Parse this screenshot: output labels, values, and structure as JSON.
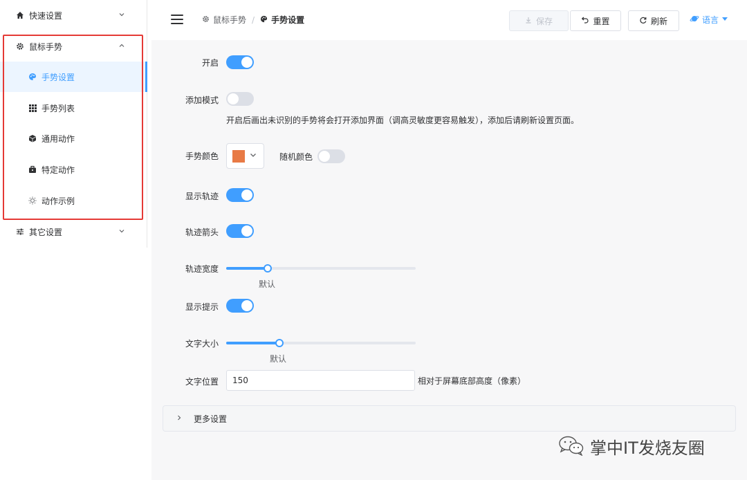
{
  "sidebar": {
    "items": [
      {
        "label": "快速设置",
        "icon": "home-icon",
        "expanded": false
      },
      {
        "label": "鼠标手势",
        "icon": "gear-icon",
        "expanded": true
      },
      {
        "label": "手势设置",
        "icon": "palette-icon",
        "active": true
      },
      {
        "label": "手势列表",
        "icon": "grid-icon"
      },
      {
        "label": "通用动作",
        "icon": "cube-icon"
      },
      {
        "label": "特定动作",
        "icon": "briefcase-icon"
      },
      {
        "label": "动作示例",
        "icon": "bulb-icon"
      },
      {
        "label": "其它设置",
        "icon": "sliders-icon",
        "expanded": false
      }
    ]
  },
  "header": {
    "breadcrumb": {
      "parent": "鼠标手势",
      "separator": "/",
      "current": "手势设置"
    },
    "save_label": "保存",
    "reset_label": "重置",
    "refresh_label": "刷新",
    "language_label": "语言"
  },
  "settings": {
    "enable": {
      "label": "开启",
      "value": true
    },
    "add_mode": {
      "label": "添加模式",
      "value": false,
      "hint": "开启后画出未识别的手势将会打开添加界面（调高灵敏度更容易触发），添加后请刷新设置页面。"
    },
    "gesture_color": {
      "label": "手势颜色",
      "value": "#e87a45"
    },
    "random_color": {
      "label": "随机颜色",
      "value": false
    },
    "show_trail": {
      "label": "显示轨迹",
      "value": true
    },
    "trail_arrow": {
      "label": "轨迹箭头",
      "value": true
    },
    "trail_width": {
      "label": "轨迹宽度",
      "fraction": 0.22,
      "caption": "默认"
    },
    "show_hint": {
      "label": "显示提示",
      "value": true
    },
    "text_size": {
      "label": "文字大小",
      "fraction": 0.28,
      "caption": "默认"
    },
    "text_position": {
      "label": "文字位置",
      "value": "150",
      "suffix": "相对于屏幕底部高度（像素）"
    }
  },
  "more_settings_label": "更多设置",
  "watermark": "掌中IT发烧友圈",
  "colors": {
    "accent": "#409eff",
    "highlight_box": "#e53935"
  }
}
